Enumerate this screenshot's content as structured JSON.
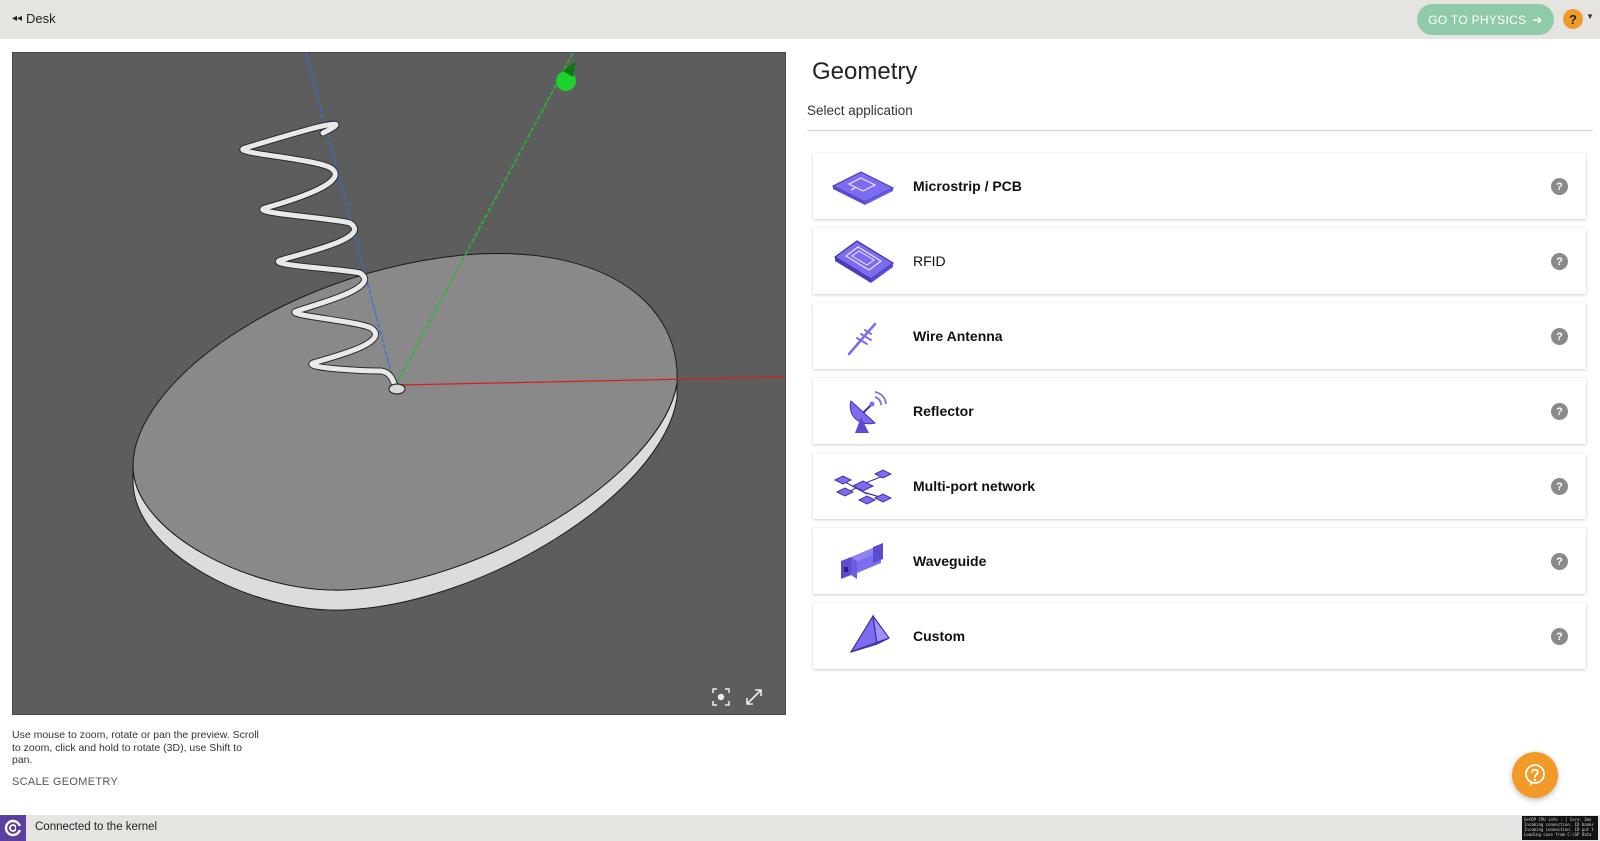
{
  "header": {
    "back_label": "Desk",
    "back_icon": "double-arrow-left",
    "physics_button": "GO TO PHYSICS",
    "physics_icon": "arrow-right",
    "help_glyph": "?",
    "accent": "#f29a27",
    "physics_color": "#8fcaa9"
  },
  "viewer": {
    "background": "#5d5d5d",
    "tools": [
      "focus-icon",
      "fullscreen-icon"
    ],
    "hint": "Use mouse to zoom, rotate or pan the preview. Scroll to zoom, click and hold to rotate (3D), use Shift to pan.",
    "scale_label": "SCALE GEOMETRY"
  },
  "panel": {
    "title": "Geometry",
    "subtitle": "Select application",
    "items": [
      {
        "label": "Microstrip / PCB",
        "icon": "microstrip-pcb-icon"
      },
      {
        "label": "RFID",
        "icon": "rfid-icon"
      },
      {
        "label": "Wire Antenna",
        "icon": "wire-antenna-icon"
      },
      {
        "label": "Reflector",
        "icon": "reflector-icon"
      },
      {
        "label": "Multi-port network",
        "icon": "multi-port-network-icon"
      },
      {
        "label": "Waveguide",
        "icon": "waveguide-icon"
      },
      {
        "label": "Custom",
        "icon": "custom-icon"
      }
    ],
    "icon_color": "#7b6cf0"
  },
  "status": {
    "text": "Connected to the kernel",
    "brand_color": "#5a3fa0",
    "console_lines": [
      "GetDP CPU info : [ Core: 2mo",
      "Incoming connection. ID banks",
      "Incoming connection. ID put t",
      "Loading case from C:\\GP Data"
    ]
  }
}
